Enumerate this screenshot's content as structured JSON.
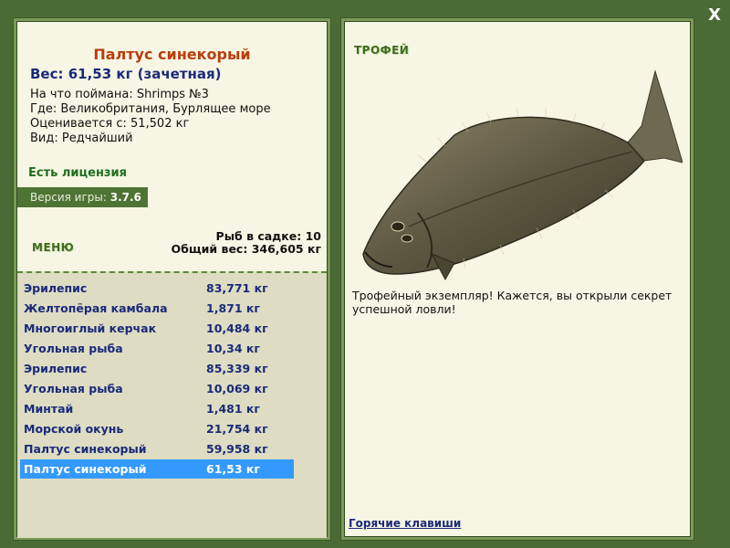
{
  "window": {
    "close_label": "X"
  },
  "fish": {
    "title": "Палтус синекорый",
    "weight": "Вес: 61,53 кг (зачетная)",
    "bait": "На что поймана: Shrimps №3",
    "location": "Где: Великобритания, Бурлящее море",
    "rated_from": "Оценивается с: 51,502 кг",
    "rarity": "Вид: Редчайший"
  },
  "license": "Есть лицензия",
  "version": {
    "label": "Версия игры:",
    "value": "3.7.6"
  },
  "menu_label": "МЕНЮ",
  "keepnet": {
    "count": "Рыб в садке: 10",
    "total_weight": "Общий вес: 346,605 кг"
  },
  "catch_list": [
    {
      "name": "Эрилепис",
      "weight": "83,771 кг"
    },
    {
      "name": "Желтопёрая камбала",
      "weight": "1,871 кг"
    },
    {
      "name": "Многоиглый керчак",
      "weight": "10,484 кг"
    },
    {
      "name": "Угольная рыба",
      "weight": "10,34 кг"
    },
    {
      "name": "Эрилепис",
      "weight": "85,339 кг"
    },
    {
      "name": "Угольная рыба",
      "weight": "10,069 кг"
    },
    {
      "name": "Минтай",
      "weight": "1,481 кг"
    },
    {
      "name": "Морской окунь",
      "weight": "21,754 кг"
    },
    {
      "name": "Палтус синекорый",
      "weight": "59,958 кг"
    },
    {
      "name": "Палтус синекорый",
      "weight": "61,53 кг"
    }
  ],
  "selected_index": 9,
  "trophy": {
    "label": "ТРОФЕЙ",
    "text": "Трофейный экземпляр! Кажется, вы открыли секрет успешной ловли!"
  },
  "hotkeys_label": "Горячие клавиши",
  "colors": {
    "frame_green": "#4a6b35",
    "panel_bg": "#f7f6e4",
    "list_bg": "#dedcc2",
    "title_orange": "#b83d0d",
    "text_navy": "#1a2a7a",
    "selection_blue": "#3399ff"
  }
}
